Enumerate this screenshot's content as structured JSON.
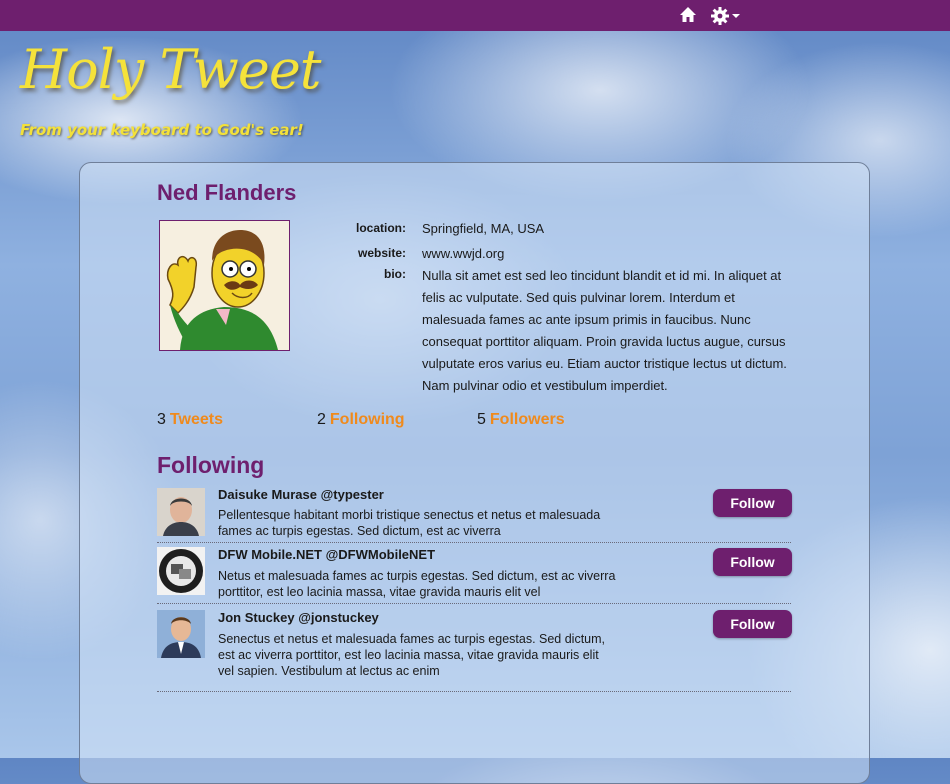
{
  "nav": {
    "home_icon": "home-icon",
    "settings_icon": "gear-icon"
  },
  "brand": {
    "title": "Holy Tweet",
    "tagline": "From your keyboard to God's ear!"
  },
  "profile": {
    "name": "Ned Flanders",
    "location_label": "location:",
    "location": "Springfield, MA, USA",
    "website_label": "website:",
    "website": "www.wwjd.org",
    "bio_label": "bio:",
    "bio": "Nulla sit amet est sed leo tincidunt blandit et id mi. In aliquet at felis ac vulputate. Sed quis pulvinar lorem. Interdum et malesuada fames ac ante ipsum primis in faucibus. Nunc consequat porttitor aliquam. Proin gravida luctus augue, cursus vulputate eros varius eu. Etiam auctor tristique lectus ut dictum. Nam pulvinar odio et vestibulum imperdiet."
  },
  "stats": [
    {
      "count": "3",
      "label": "Tweets"
    },
    {
      "count": "2",
      "label": "Following"
    },
    {
      "count": "5",
      "label": "Followers"
    }
  ],
  "following": {
    "title": "Following",
    "items": [
      {
        "name": "Daisuke Murase @typester",
        "text": "Pellentesque habitant morbi tristique senectus et netus et malesuada fames ac turpis egestas. Sed dictum, est ac viverra",
        "button": "Follow"
      },
      {
        "name": "DFW Mobile.NET @DFWMobileNET",
        "text": "Netus et malesuada fames ac turpis egestas. Sed dictum, est ac viverra porttitor, est leo lacinia massa, vitae gravida mauris elit vel",
        "button": "Follow"
      },
      {
        "name": "Jon Stuckey @jonstuckey",
        "text": "Senectus et netus et malesuada fames ac turpis egestas. Sed dictum, est ac viverra porttitor, est leo lacinia massa, vitae gravida mauris elit vel sapien. Vestibulum at lectus ac enim",
        "button": "Follow"
      }
    ]
  },
  "colors": {
    "brand_purple": "#6e1f6e",
    "accent_orange": "#f08a1c",
    "logo_yellow": "#f5e23a"
  }
}
